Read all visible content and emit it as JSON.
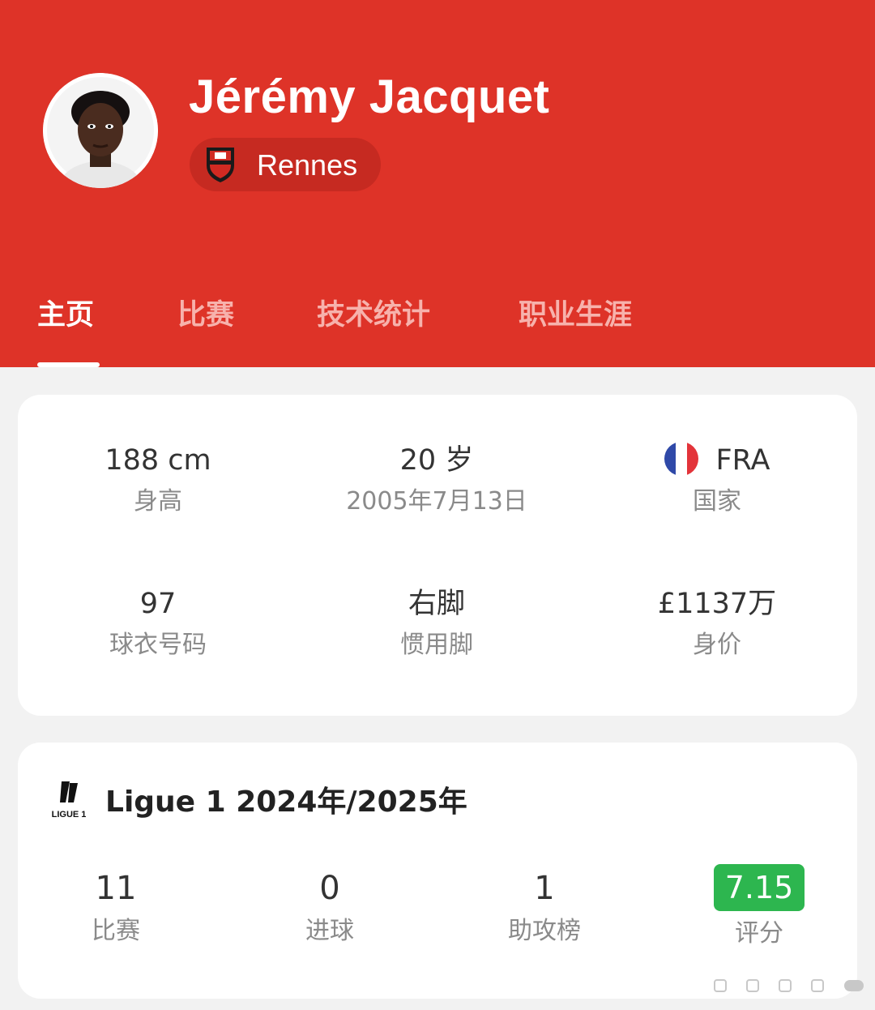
{
  "player": {
    "name": "Jérémy Jacquet",
    "club": "Rennes"
  },
  "tabs": [
    {
      "label": "主页",
      "active": true
    },
    {
      "label": "比赛",
      "active": false
    },
    {
      "label": "技术统计",
      "active": false
    },
    {
      "label": "职业生涯",
      "active": false
    }
  ],
  "info": {
    "height": {
      "value": "188 cm",
      "label": "身高"
    },
    "age": {
      "value": "20 岁",
      "label": "2005年7月13日"
    },
    "country": {
      "value": "FRA",
      "label": "国家",
      "flag_icon": "france-flag-icon"
    },
    "shirt": {
      "value": "97",
      "label": "球衣号码"
    },
    "foot": {
      "value": "右脚",
      "label": "惯用脚"
    },
    "market_value": {
      "value": "£1137万",
      "label": "身价"
    }
  },
  "season": {
    "league_logo_icon": "ligue1-logo-icon",
    "title": "Ligue 1 2024年/2025年",
    "stats": [
      {
        "value": "11",
        "label": "比赛"
      },
      {
        "value": "0",
        "label": "进球"
      },
      {
        "value": "1",
        "label": "助攻榜"
      },
      {
        "value": "7.15",
        "label": "评分"
      }
    ]
  },
  "colors": {
    "header_red": "#de3328",
    "rating_green": "#2db64f",
    "tab_inactive": "#f7b2ac"
  }
}
